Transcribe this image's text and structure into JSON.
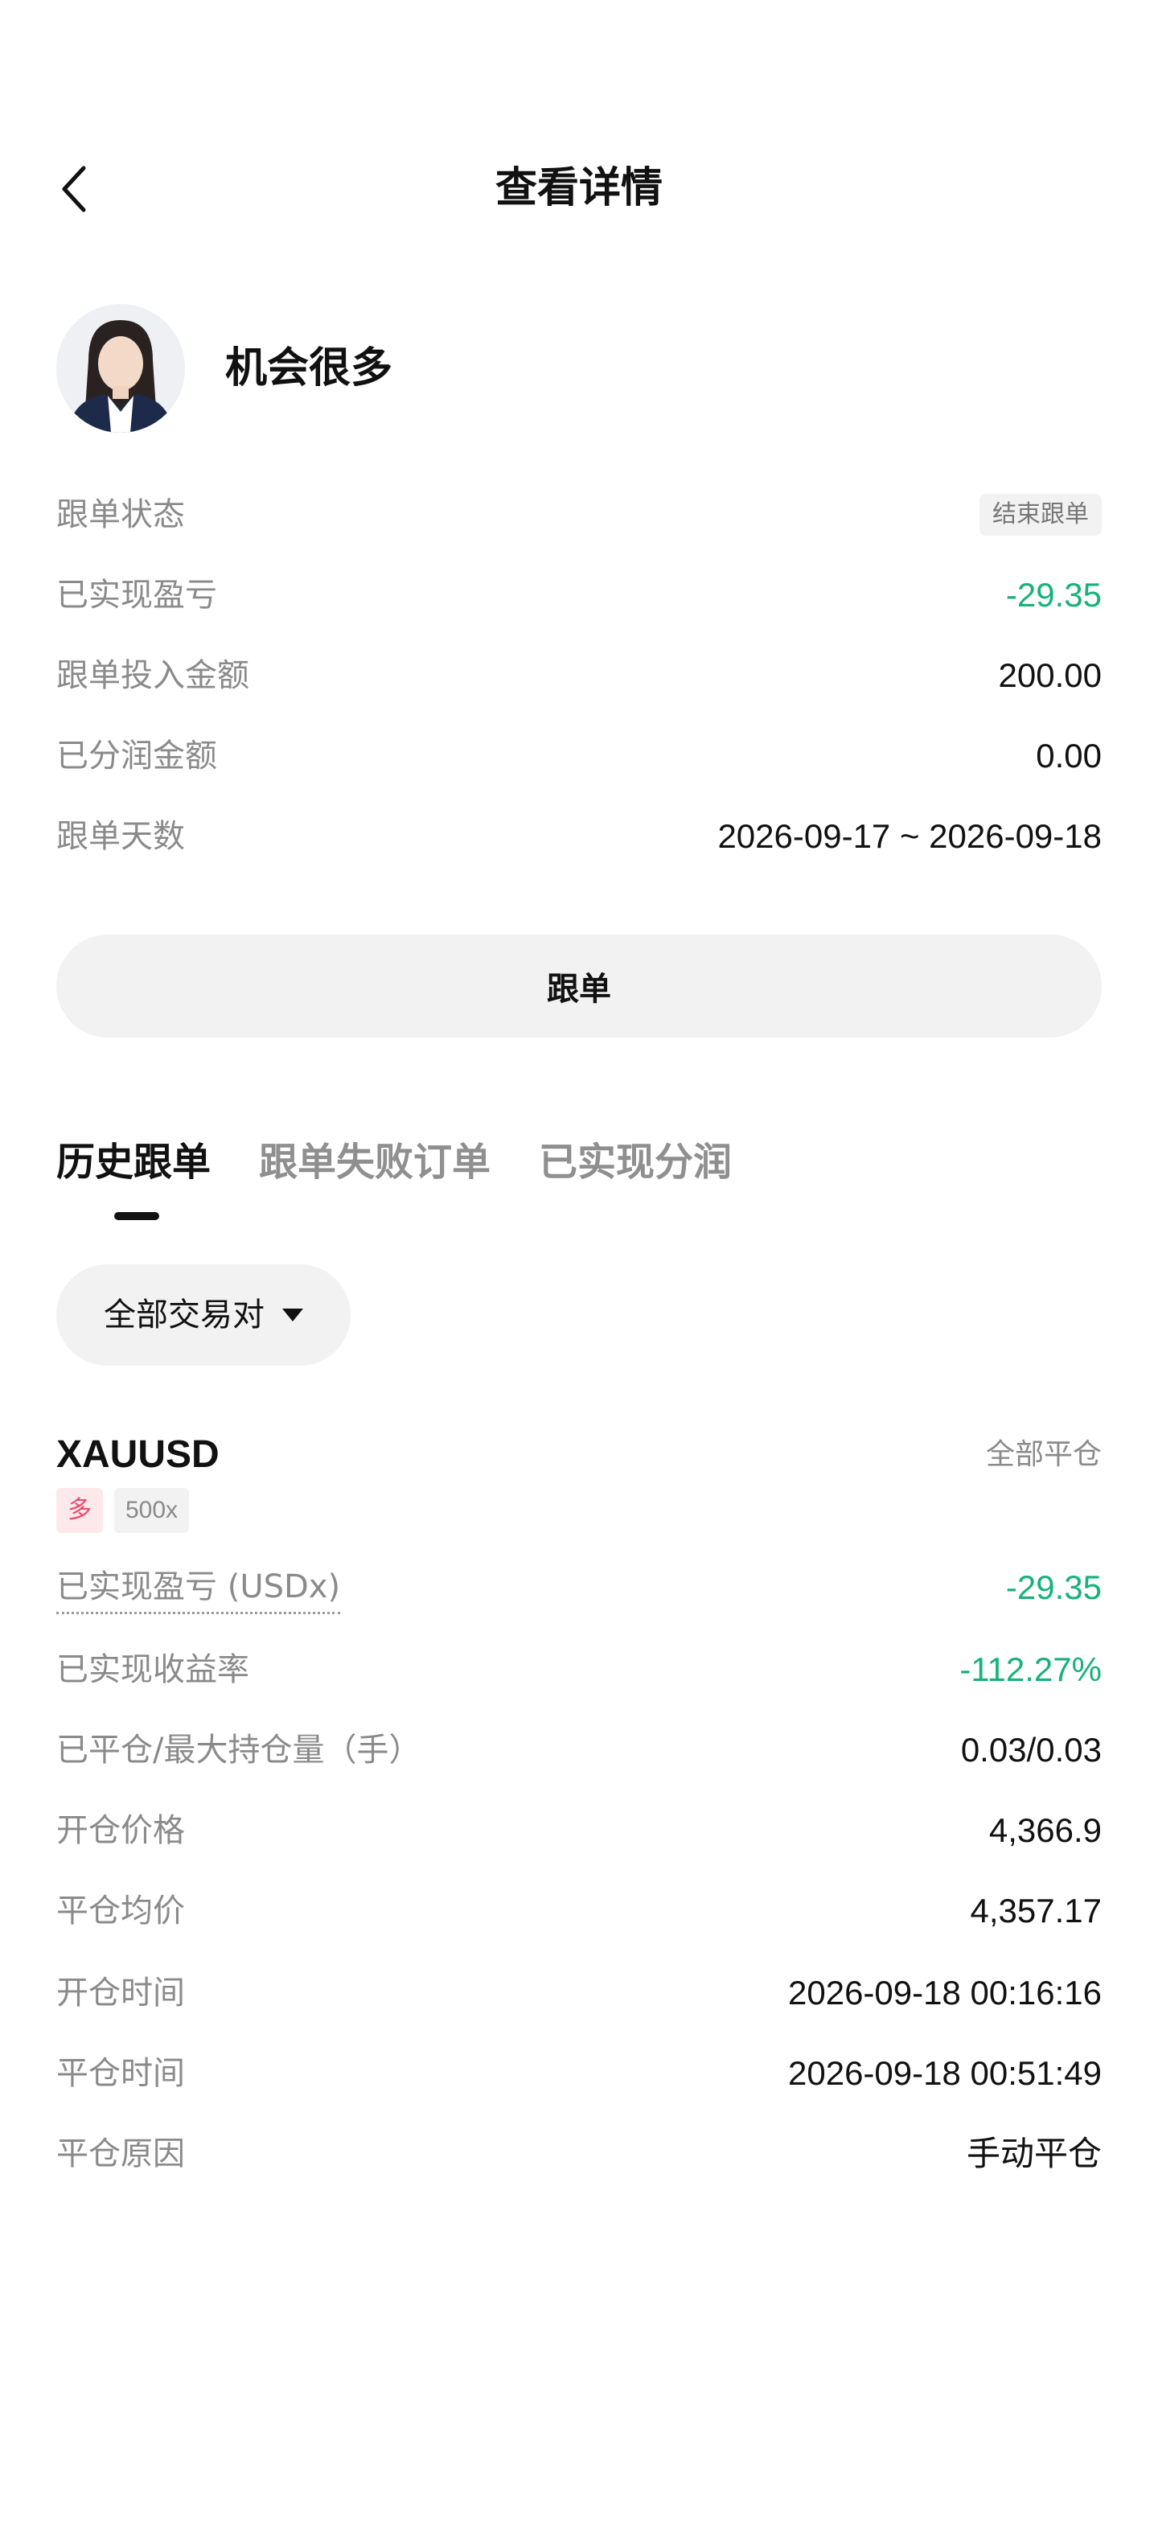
{
  "header": {
    "title": "查看详情",
    "back_icon": "chevron-left-icon"
  },
  "trader": {
    "name": "机会很多"
  },
  "summary": {
    "status_label": "跟单状态",
    "status_value": "结束跟单",
    "realized_pnl_label": "已实现盈亏",
    "realized_pnl_value": "-29.35",
    "invest_label": "跟单投入金额",
    "invest_value": "200.00",
    "profit_share_label": "已分润金额",
    "profit_share_value": "0.00",
    "days_label": "跟单天数",
    "days_value": "2026-09-17 ~ 2026-09-18"
  },
  "follow_button_label": "跟单",
  "tabs": [
    {
      "label": "历史跟单",
      "active": true
    },
    {
      "label": "跟单失败订单",
      "active": false
    },
    {
      "label": "已实现分润",
      "active": false
    }
  ],
  "filter": {
    "label": "全部交易对"
  },
  "order": {
    "symbol": "XAUUSD",
    "close_type": "全部平仓",
    "side_tag": "多",
    "leverage_tag": "500x",
    "rows": [
      {
        "label": "已实现盈亏 (USDx)",
        "value": "-29.35"
      },
      {
        "label": "已实现收益率",
        "value": "-112.27%"
      },
      {
        "label": "已平仓/最大持仓量（手）",
        "value": "0.03/0.03"
      },
      {
        "label": "开仓价格",
        "value": "4,366.9"
      },
      {
        "label": "平仓均价",
        "value": "4,357.17"
      },
      {
        "label": "开仓时间",
        "value": "2026-09-18 00:16:16"
      },
      {
        "label": "平仓时间",
        "value": "2026-09-18 00:51:49"
      },
      {
        "label": "平仓原因",
        "value": "手动平仓"
      }
    ]
  },
  "colors": {
    "positive_loss_green": "#17b27a",
    "long_tag": "#e84b6b"
  }
}
